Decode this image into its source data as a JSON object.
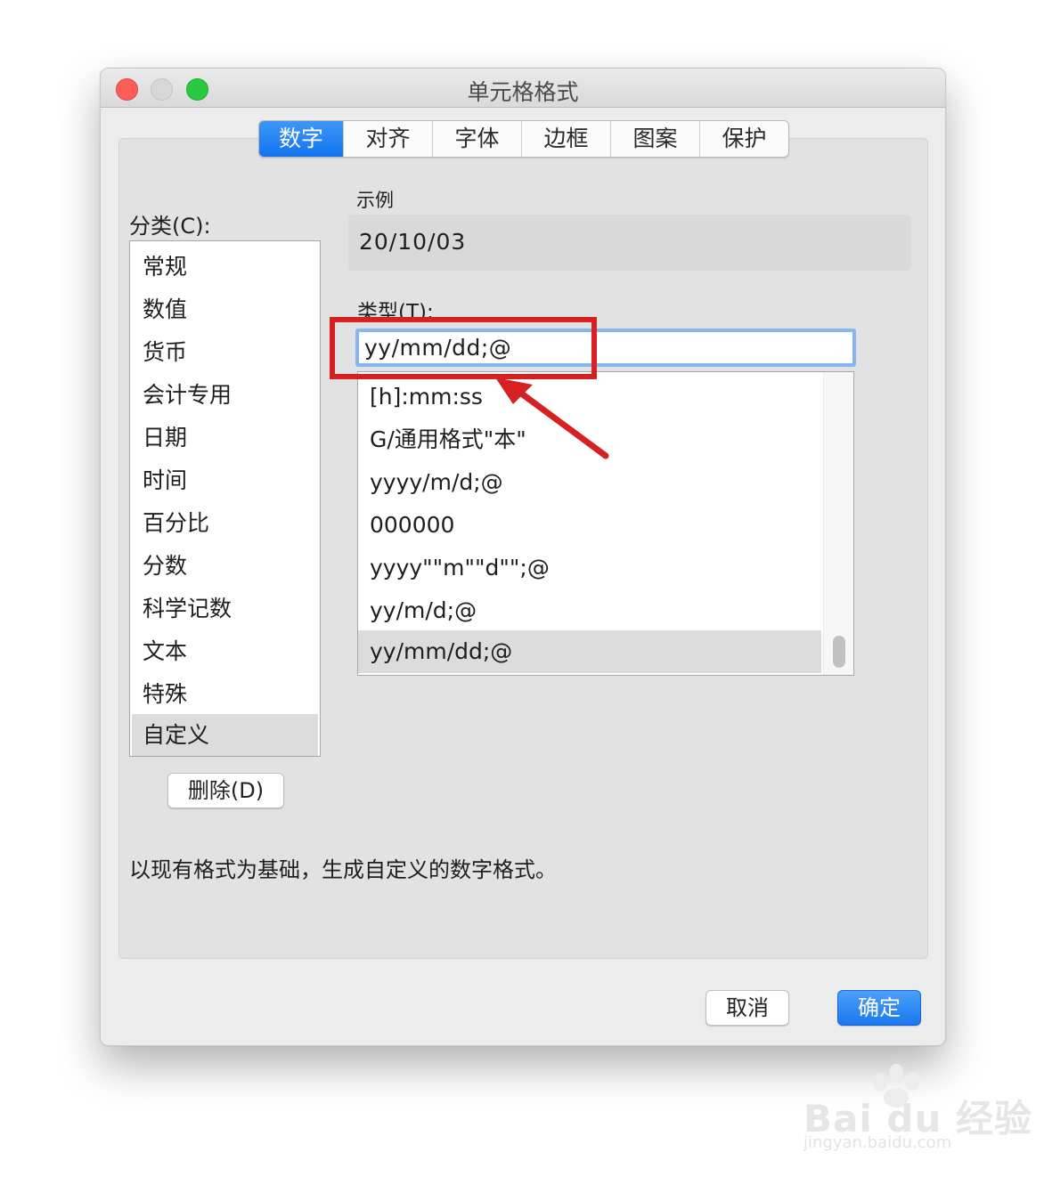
{
  "window": {
    "title": "单元格格式"
  },
  "tabs": [
    {
      "label": "数字",
      "active": true
    },
    {
      "label": "对齐",
      "active": false
    },
    {
      "label": "字体",
      "active": false
    },
    {
      "label": "边框",
      "active": false
    },
    {
      "label": "图案",
      "active": false
    },
    {
      "label": "保护",
      "active": false
    }
  ],
  "category": {
    "label": "分类(C):",
    "items": [
      "常规",
      "数值",
      "货币",
      "会计专用",
      "日期",
      "时间",
      "百分比",
      "分数",
      "科学记数",
      "文本",
      "特殊",
      "自定义"
    ],
    "selected": "自定义"
  },
  "sample": {
    "label": "示例",
    "value": "20/10/03"
  },
  "type": {
    "label": "类型(T):",
    "input_value": "yy/mm/dd;@",
    "items": [
      "[h]:mm:ss",
      "G/通用格式\"本\"",
      "yyyy/m/d;@",
      "000000",
      "yyyy\"\"m\"\"d\"\";@",
      "yy/m/d;@",
      "yy/mm/dd;@"
    ],
    "selected": "yy/mm/dd;@"
  },
  "delete_button": "删除(D)",
  "description": "以现有格式为基础，生成自定义的数字格式。",
  "buttons": {
    "cancel": "取消",
    "ok": "确定"
  },
  "watermark": {
    "brand": "Bai du 经验",
    "url": "jingyan.baidu.com"
  },
  "colors": {
    "accent": "#1a78ef",
    "highlight_red": "#d62122"
  }
}
